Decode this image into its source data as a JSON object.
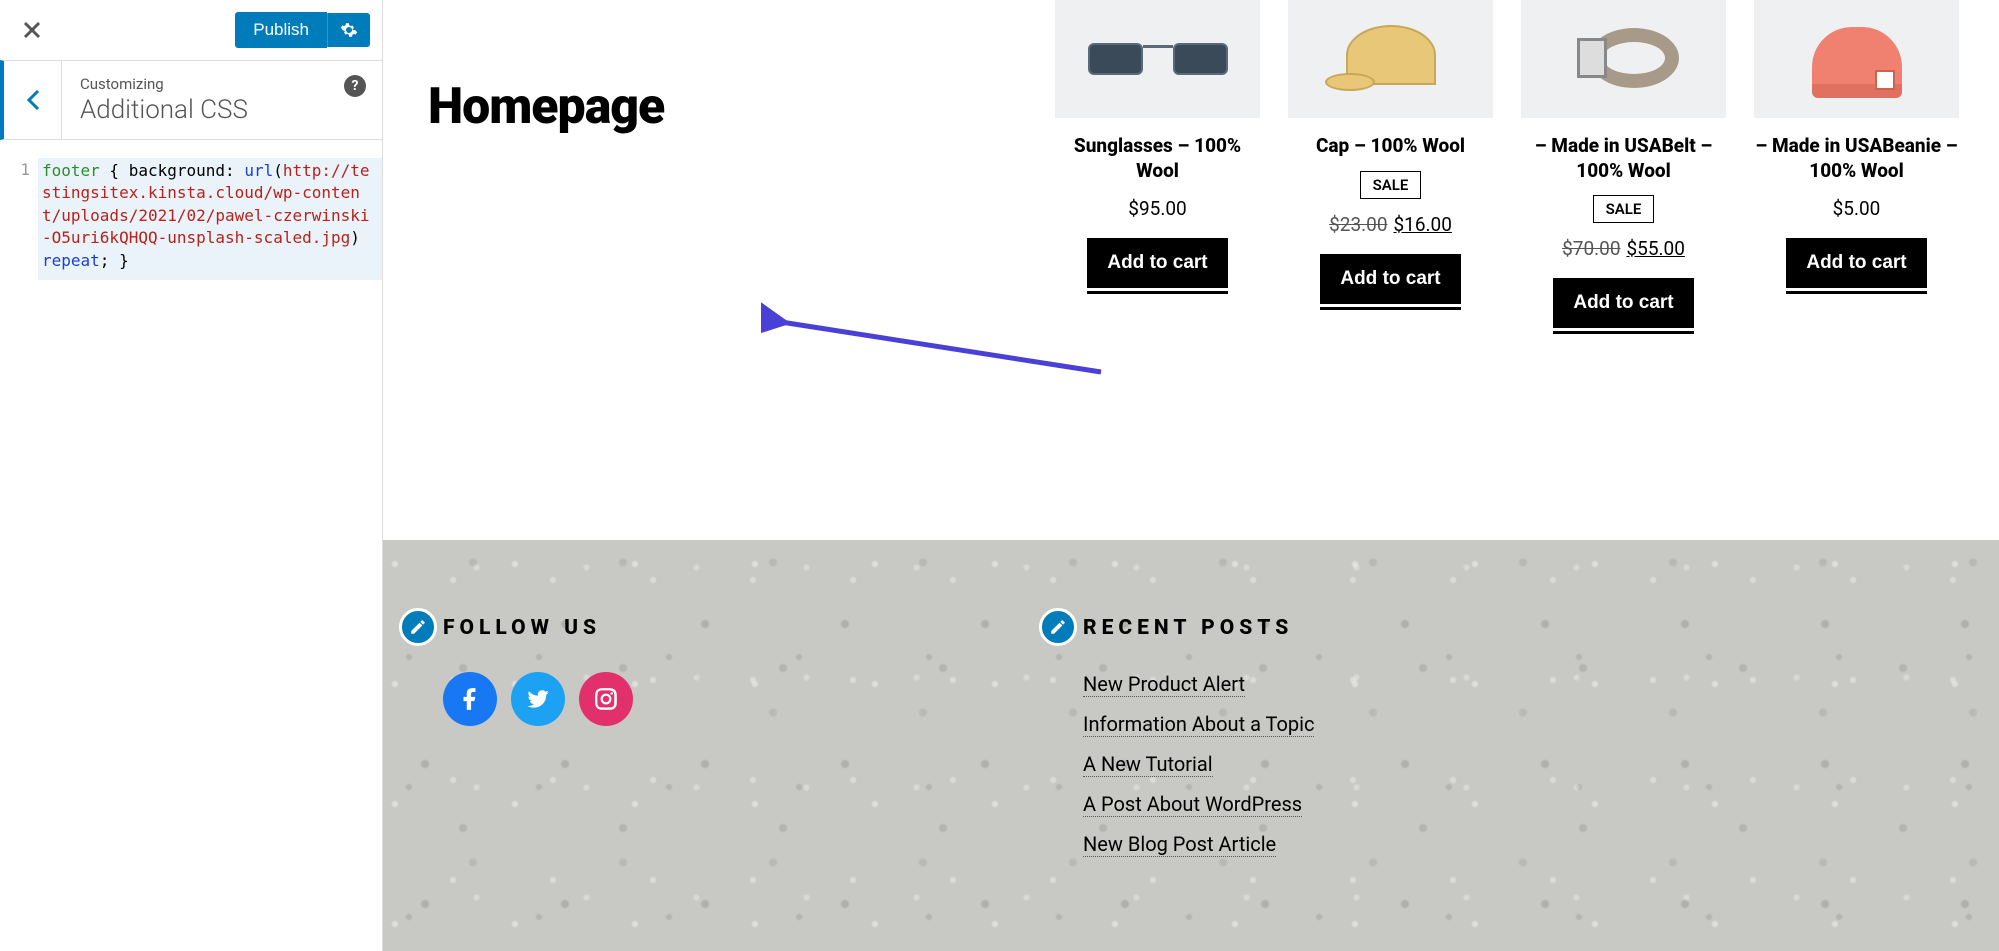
{
  "sidebar": {
    "publish_label": "Publish",
    "customizing_label": "Customizing",
    "section_title": "Additional CSS",
    "code": {
      "line_number": "1",
      "selector": "footer",
      "open": " { ",
      "prop": "background:",
      "url_kw": "url",
      "url_open": "(",
      "url_value": "http://testingsitex.kinsta.cloud/wp-content/uploads/2021/02/pawel-czerwinski-O5uri6kQHQQ-unsplash-scaled.jpg",
      "url_close": ")",
      "repeat": " repeat",
      "close": "; }"
    }
  },
  "preview": {
    "page_title": "Homepage",
    "products": [
      {
        "name": "Sunglasses – 100% Wool",
        "sale": false,
        "old_price": "",
        "price": "$95.00",
        "btn": "Add to cart"
      },
      {
        "name": "Cap – 100% Wool",
        "sale": true,
        "sale_label": "SALE",
        "old_price": "$23.00",
        "price": "$16.00",
        "btn": "Add to cart"
      },
      {
        "name": "– Made in USABelt – 100% Wool",
        "sale": true,
        "sale_label": "SALE",
        "old_price": "$70.00",
        "price": "$55.00",
        "btn": "Add to cart"
      },
      {
        "name": "– Made in USABeanie – 100% Wool",
        "sale": false,
        "old_price": "",
        "price": "$5.00",
        "btn": "Add to cart"
      }
    ],
    "footer": {
      "follow_us": "FOLLOW US",
      "recent_posts": "RECENT POSTS",
      "posts": [
        "New Product Alert",
        "Information About a Topic",
        "A New Tutorial",
        "A Post About WordPress",
        "New Blog Post Article"
      ]
    }
  }
}
